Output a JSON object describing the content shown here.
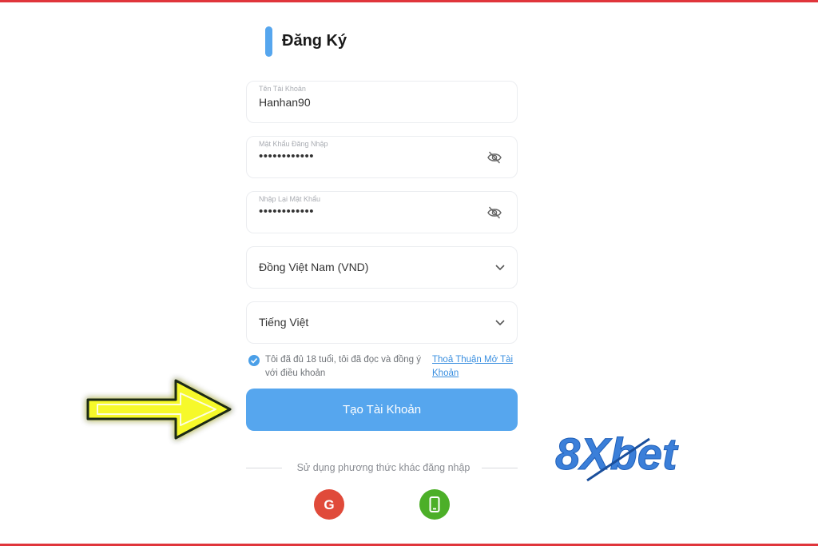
{
  "page": {
    "title": "Đăng Ký"
  },
  "form": {
    "username": {
      "label": "Tên Tài Khoản",
      "value": "Hanhan90"
    },
    "password": {
      "label": "Mật Khẩu Đăng Nhập",
      "value": "••••••••••••"
    },
    "confirm_password": {
      "label": "Nhập Lại Mật Khẩu",
      "value": "••••••••••••"
    },
    "currency": {
      "selected": "Đồng Việt Nam (VND)"
    },
    "language": {
      "selected": "Tiếng Việt"
    },
    "terms": {
      "text": "Tôi đã đủ 18 tuổi, tôi đã đọc và đồng ý với điều khoản",
      "link": "Thoả Thuận Mở Tài Khoản",
      "checked": true
    },
    "submit_label": "Tạo Tài Khoản"
  },
  "alt_login": {
    "label": "Sử dụng phương thức khác đăng nhập",
    "google_glyph": "G",
    "icons": [
      "google-icon",
      "phone-icon"
    ]
  },
  "brand": {
    "logo_text": "8Xbet",
    "color": "#3b7fd9"
  },
  "colors": {
    "accent": "#56a6ee",
    "frame": "#e0353b",
    "arrow": "#f2f21e"
  }
}
